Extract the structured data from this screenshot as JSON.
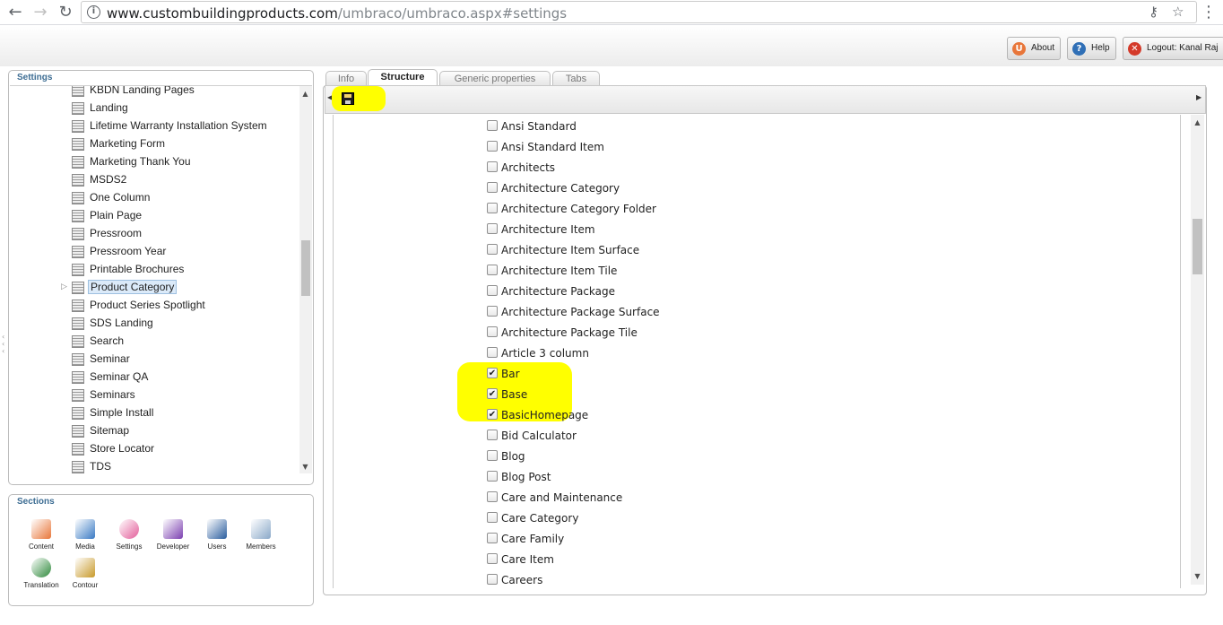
{
  "browser": {
    "url_host": "www.custombuildingproducts.com",
    "url_path": "/umbraco/umbraco.aspx#settings"
  },
  "header": {
    "about_label": "About",
    "help_label": "Help",
    "logout_label": "Logout: Kanal Raj"
  },
  "settings_panel": {
    "title": "Settings",
    "items": [
      "KBDN Landing Pages",
      "Landing",
      "Lifetime Warranty Installation System",
      "Marketing Form",
      "Marketing Thank You",
      "MSDS2",
      "One Column",
      "Plain Page",
      "Pressroom",
      "Pressroom Year",
      "Printable Brochures",
      "Product Category",
      "Product Series Spotlight",
      "SDS Landing",
      "Search",
      "Seminar",
      "Seminar QA",
      "Seminars",
      "Simple Install",
      "Sitemap",
      "Store Locator",
      "TDS"
    ],
    "selected_item": "Product Category"
  },
  "sections_panel": {
    "title": "Sections",
    "items": [
      {
        "label": "Content",
        "icon": "content-icon",
        "color": "#e8763a"
      },
      {
        "label": "Media",
        "icon": "media-icon",
        "color": "#3a7ac4"
      },
      {
        "label": "Settings",
        "icon": "settings-icon",
        "color": "#e35d9a"
      },
      {
        "label": "Developer",
        "icon": "developer-icon",
        "color": "#7b3fb0"
      },
      {
        "label": "Users",
        "icon": "users-icon",
        "color": "#2a5d9e"
      },
      {
        "label": "Members",
        "icon": "members-icon",
        "color": "#8aa8c8"
      },
      {
        "label": "Translation",
        "icon": "translation-icon",
        "color": "#2f8a3c"
      },
      {
        "label": "Contour",
        "icon": "contour-icon",
        "color": "#c89a2a"
      }
    ]
  },
  "tabs": [
    "Info",
    "Structure",
    "Generic properties",
    "Tabs"
  ],
  "active_tab": "Structure",
  "toolbar": {
    "save_icon": "save-icon"
  },
  "allowed_child_types": [
    {
      "label": "Ansi Standard",
      "checked": false
    },
    {
      "label": "Ansi Standard Item",
      "checked": false
    },
    {
      "label": "Architects",
      "checked": false
    },
    {
      "label": "Architecture Category",
      "checked": false
    },
    {
      "label": "Architecture Category Folder",
      "checked": false
    },
    {
      "label": "Architecture Item",
      "checked": false
    },
    {
      "label": "Architecture Item Surface",
      "checked": false
    },
    {
      "label": "Architecture Item Tile",
      "checked": false
    },
    {
      "label": "Architecture Package",
      "checked": false
    },
    {
      "label": "Architecture Package Surface",
      "checked": false
    },
    {
      "label": "Architecture Package Tile",
      "checked": false
    },
    {
      "label": "Article 3 column",
      "checked": false
    },
    {
      "label": "Bar",
      "checked": true
    },
    {
      "label": "Base",
      "checked": true
    },
    {
      "label": "BasicHomepage",
      "checked": true
    },
    {
      "label": "Bid Calculator",
      "checked": false
    },
    {
      "label": "Blog",
      "checked": false
    },
    {
      "label": "Blog Post",
      "checked": false
    },
    {
      "label": "Care and Maintenance",
      "checked": false
    },
    {
      "label": "Care Category",
      "checked": false
    },
    {
      "label": "Care Family",
      "checked": false
    },
    {
      "label": "Care Item",
      "checked": false
    },
    {
      "label": "Careers",
      "checked": false
    }
  ],
  "colors": {
    "highlight": "#ffff00",
    "panel_title": "#3d6d93",
    "selection": "#dbeaf9"
  }
}
